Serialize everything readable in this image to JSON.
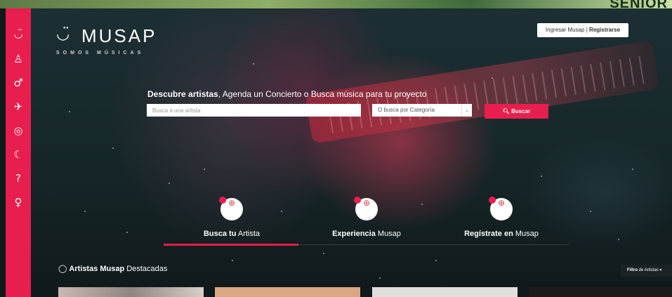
{
  "banner_text": "SENIOR",
  "sidebar": {
    "icons": [
      "smile-logo-icon",
      "people-icon",
      "male-icon",
      "plane-icon",
      "instagram-icon",
      "moon-icon",
      "question-icon",
      "female-icon"
    ],
    "color": "#e81e4e"
  },
  "logo": {
    "name": "MUSAP",
    "tagline": "SOMOS MÚSICAS"
  },
  "auth": {
    "login": "Ingresar Musap",
    "separator": " | ",
    "register": "Registrarse"
  },
  "search": {
    "title_bold": "Descubre artistas",
    "title_rest": ", Agenda un Concierto o Busca música para tu proyecto",
    "input_placeholder": "Busca a una artista",
    "category_placeholder": "O busca por Categoría",
    "button_icon": "search-icon",
    "button_label": "Buscar"
  },
  "features": [
    {
      "bold": "Busca tu",
      "rest": " Artista",
      "icon": "search-icon",
      "active": true
    },
    {
      "bold": "Experiencia",
      "rest": " Musap",
      "icon": "search-icon",
      "active": false
    },
    {
      "bold": "Regístrate en",
      "rest": " Musap",
      "icon": "search-icon",
      "active": false
    }
  ],
  "section": {
    "icon": "circle-icon",
    "bold": "Artistas Musap",
    "rest": " Destacadas"
  },
  "filter": {
    "bold": "Filtro",
    "rest": " de Artistas",
    "chevron": "chevron-down-icon"
  },
  "colors": {
    "accent": "#e81e4e",
    "white": "#ffffff"
  }
}
